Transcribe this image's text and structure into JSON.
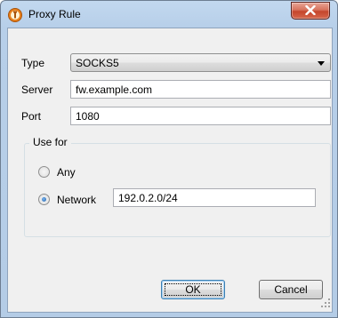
{
  "window": {
    "title": "Proxy Rule",
    "icon": "tor-onion-icon",
    "accent": "#3c7fb1"
  },
  "form": {
    "type_label": "Type",
    "type_value": "SOCKS5",
    "server_label": "Server",
    "server_value": "fw.example.com",
    "port_label": "Port",
    "port_value": "1080"
  },
  "use_for": {
    "title": "Use for",
    "any_label": "Any",
    "network_label": "Network",
    "network_value": "192.0.2.0/24",
    "selected": "network"
  },
  "buttons": {
    "ok": "OK",
    "cancel": "Cancel"
  }
}
